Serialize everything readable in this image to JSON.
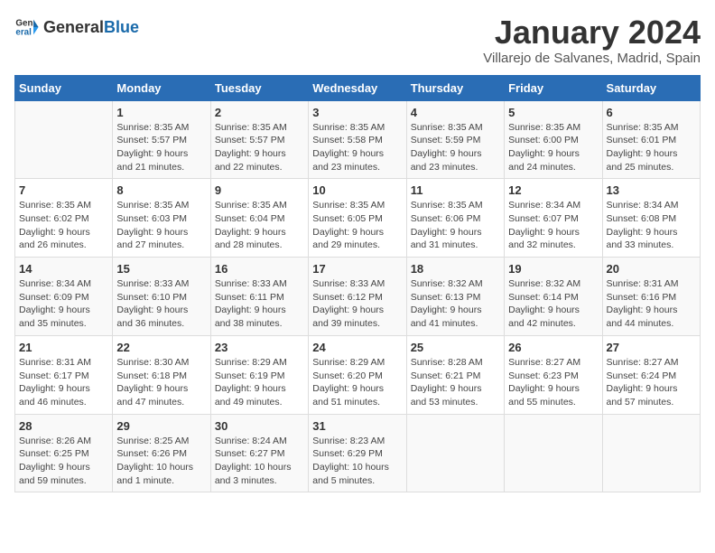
{
  "header": {
    "logo_general": "General",
    "logo_blue": "Blue",
    "title": "January 2024",
    "subtitle": "Villarejo de Salvanes, Madrid, Spain"
  },
  "days": [
    "Sunday",
    "Monday",
    "Tuesday",
    "Wednesday",
    "Thursday",
    "Friday",
    "Saturday"
  ],
  "weeks": [
    [
      {
        "date": "",
        "info": ""
      },
      {
        "date": "1",
        "info": "Sunrise: 8:35 AM\nSunset: 5:57 PM\nDaylight: 9 hours\nand 21 minutes."
      },
      {
        "date": "2",
        "info": "Sunrise: 8:35 AM\nSunset: 5:57 PM\nDaylight: 9 hours\nand 22 minutes."
      },
      {
        "date": "3",
        "info": "Sunrise: 8:35 AM\nSunset: 5:58 PM\nDaylight: 9 hours\nand 23 minutes."
      },
      {
        "date": "4",
        "info": "Sunrise: 8:35 AM\nSunset: 5:59 PM\nDaylight: 9 hours\nand 23 minutes."
      },
      {
        "date": "5",
        "info": "Sunrise: 8:35 AM\nSunset: 6:00 PM\nDaylight: 9 hours\nand 24 minutes."
      },
      {
        "date": "6",
        "info": "Sunrise: 8:35 AM\nSunset: 6:01 PM\nDaylight: 9 hours\nand 25 minutes."
      }
    ],
    [
      {
        "date": "7",
        "info": "Sunrise: 8:35 AM\nSunset: 6:02 PM\nDaylight: 9 hours\nand 26 minutes."
      },
      {
        "date": "8",
        "info": "Sunrise: 8:35 AM\nSunset: 6:03 PM\nDaylight: 9 hours\nand 27 minutes."
      },
      {
        "date": "9",
        "info": "Sunrise: 8:35 AM\nSunset: 6:04 PM\nDaylight: 9 hours\nand 28 minutes."
      },
      {
        "date": "10",
        "info": "Sunrise: 8:35 AM\nSunset: 6:05 PM\nDaylight: 9 hours\nand 29 minutes."
      },
      {
        "date": "11",
        "info": "Sunrise: 8:35 AM\nSunset: 6:06 PM\nDaylight: 9 hours\nand 31 minutes."
      },
      {
        "date": "12",
        "info": "Sunrise: 8:34 AM\nSunset: 6:07 PM\nDaylight: 9 hours\nand 32 minutes."
      },
      {
        "date": "13",
        "info": "Sunrise: 8:34 AM\nSunset: 6:08 PM\nDaylight: 9 hours\nand 33 minutes."
      }
    ],
    [
      {
        "date": "14",
        "info": "Sunrise: 8:34 AM\nSunset: 6:09 PM\nDaylight: 9 hours\nand 35 minutes."
      },
      {
        "date": "15",
        "info": "Sunrise: 8:33 AM\nSunset: 6:10 PM\nDaylight: 9 hours\nand 36 minutes."
      },
      {
        "date": "16",
        "info": "Sunrise: 8:33 AM\nSunset: 6:11 PM\nDaylight: 9 hours\nand 38 minutes."
      },
      {
        "date": "17",
        "info": "Sunrise: 8:33 AM\nSunset: 6:12 PM\nDaylight: 9 hours\nand 39 minutes."
      },
      {
        "date": "18",
        "info": "Sunrise: 8:32 AM\nSunset: 6:13 PM\nDaylight: 9 hours\nand 41 minutes."
      },
      {
        "date": "19",
        "info": "Sunrise: 8:32 AM\nSunset: 6:14 PM\nDaylight: 9 hours\nand 42 minutes."
      },
      {
        "date": "20",
        "info": "Sunrise: 8:31 AM\nSunset: 6:16 PM\nDaylight: 9 hours\nand 44 minutes."
      }
    ],
    [
      {
        "date": "21",
        "info": "Sunrise: 8:31 AM\nSunset: 6:17 PM\nDaylight: 9 hours\nand 46 minutes."
      },
      {
        "date": "22",
        "info": "Sunrise: 8:30 AM\nSunset: 6:18 PM\nDaylight: 9 hours\nand 47 minutes."
      },
      {
        "date": "23",
        "info": "Sunrise: 8:29 AM\nSunset: 6:19 PM\nDaylight: 9 hours\nand 49 minutes."
      },
      {
        "date": "24",
        "info": "Sunrise: 8:29 AM\nSunset: 6:20 PM\nDaylight: 9 hours\nand 51 minutes."
      },
      {
        "date": "25",
        "info": "Sunrise: 8:28 AM\nSunset: 6:21 PM\nDaylight: 9 hours\nand 53 minutes."
      },
      {
        "date": "26",
        "info": "Sunrise: 8:27 AM\nSunset: 6:23 PM\nDaylight: 9 hours\nand 55 minutes."
      },
      {
        "date": "27",
        "info": "Sunrise: 8:27 AM\nSunset: 6:24 PM\nDaylight: 9 hours\nand 57 minutes."
      }
    ],
    [
      {
        "date": "28",
        "info": "Sunrise: 8:26 AM\nSunset: 6:25 PM\nDaylight: 9 hours\nand 59 minutes."
      },
      {
        "date": "29",
        "info": "Sunrise: 8:25 AM\nSunset: 6:26 PM\nDaylight: 10 hours\nand 1 minute."
      },
      {
        "date": "30",
        "info": "Sunrise: 8:24 AM\nSunset: 6:27 PM\nDaylight: 10 hours\nand 3 minutes."
      },
      {
        "date": "31",
        "info": "Sunrise: 8:23 AM\nSunset: 6:29 PM\nDaylight: 10 hours\nand 5 minutes."
      },
      {
        "date": "",
        "info": ""
      },
      {
        "date": "",
        "info": ""
      },
      {
        "date": "",
        "info": ""
      }
    ]
  ]
}
